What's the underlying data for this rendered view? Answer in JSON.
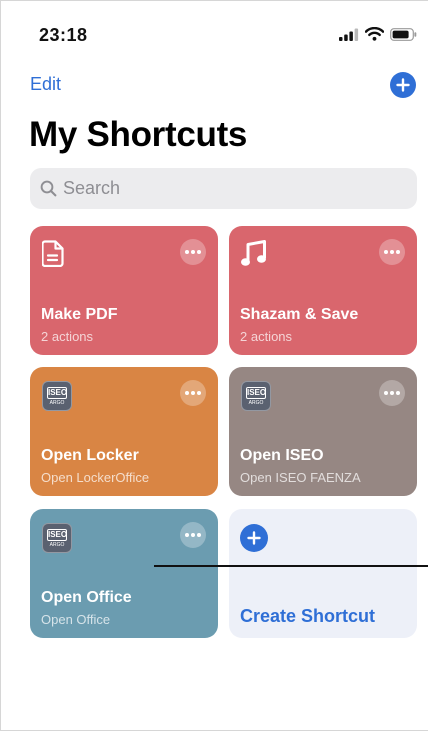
{
  "status_bar": {
    "time": "23:18"
  },
  "header": {
    "edit_label": "Edit",
    "title": "My Shortcuts"
  },
  "search": {
    "placeholder": "Search"
  },
  "shortcuts": [
    {
      "title": "Make PDF",
      "subtitle": "2 actions",
      "icon": "document-icon",
      "color": "#d9666d"
    },
    {
      "title": "Shazam & Save",
      "subtitle": "2 actions",
      "icon": "music-note-icon",
      "color": "#d9666d"
    },
    {
      "title": "Open Locker",
      "subtitle": "Open LockerOffice",
      "icon": "iseo-app-icon",
      "color": "#d98544"
    },
    {
      "title": "Open ISEO",
      "subtitle": "Open ISEO FAENZA",
      "icon": "iseo-app-icon",
      "color": "#968783"
    },
    {
      "title": "Open Office",
      "subtitle": "Open Office",
      "icon": "iseo-app-icon",
      "color": "#6b9cb0"
    }
  ],
  "create_shortcut": {
    "label": "Create Shortcut",
    "color": "#edf0f8"
  },
  "iseo_logo": {
    "brand": "ISEO",
    "sub": "ARGO"
  },
  "colors": {
    "accent": "#2f6fd6"
  }
}
